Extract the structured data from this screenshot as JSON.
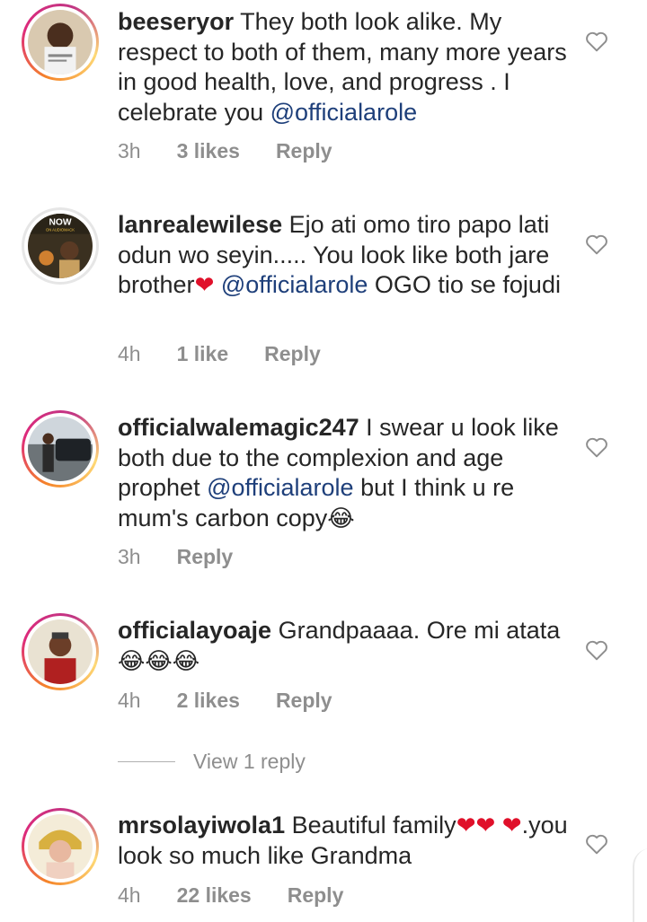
{
  "comments": [
    {
      "username": "beeseryor",
      "text_before": " They both look alike. My respect to both of them, many more years in good health, love, and progress . I celebrate you ",
      "mention": "@officialarole",
      "text_after": "",
      "time": "3h",
      "likes": "3 likes",
      "reply": "Reply",
      "story_ring": true
    },
    {
      "username": "lanrealewilese",
      "text_before": " Ejo ati omo tiro papo lati odun wo seyin..... You look like both jare brother",
      "heart": "❤",
      "mention": "@officialarole",
      "text_after": " OGO tio se fojudi",
      "time": "4h",
      "likes": "1 like",
      "reply": "Reply",
      "avatar_text_top": "NOW",
      "avatar_text_sub": "ON AUDIOMACK",
      "story_ring": false
    },
    {
      "username": "officialwalemagic247",
      "text_before": " I swear u look like both due to the complexion and age prophet ",
      "mention": "@officialarole",
      "text_after": " but I think u re mum's carbon copy",
      "emoji": "😂",
      "time": "3h",
      "likes": "",
      "reply": "Reply",
      "story_ring": true
    },
    {
      "username": "officialayoaje",
      "text_before": " Grandpaaaa. Ore mi atata ",
      "emoji": "😂😂😂",
      "time": "4h",
      "likes": "2 likes",
      "reply": "Reply",
      "story_ring": true
    },
    {
      "username": "mrsolayiwola1",
      "text_before": " Beautiful family",
      "hearts": "❤❤",
      "heart2": "❤",
      "text_after": ".you look so much like Grandma",
      "time": "4h",
      "likes": "22 likes",
      "reply": "Reply",
      "story_ring": true
    }
  ],
  "view_replies": "View 1 reply",
  "icons": {
    "like": "heart-outline-icon"
  },
  "colors": {
    "mention": "#1e3f7a",
    "meta": "#8e8e8e",
    "heart": "#e0102a"
  }
}
